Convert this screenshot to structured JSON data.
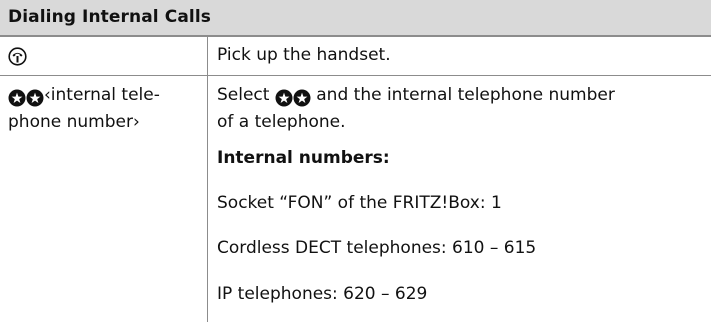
{
  "header": {
    "title": "Dialing Internal Calls"
  },
  "rows": [
    {
      "action_icon": "handset-icon",
      "instruction": "Pick up the handset."
    },
    {
      "action_icons": [
        "star-key-icon",
        "star-key-icon"
      ],
      "action_text_line1": "‹internal tele-",
      "action_text_line2": "phone number›",
      "instruction_prefix": "Select",
      "instruction_suffix": "and the internal telephone number",
      "instruction_line2": "of a telephone.",
      "subheading": "Internal numbers:",
      "numbers": [
        "Socket “FON” of the FRITZ!Box: 1",
        "Cordless DECT telephones: 610 – 615",
        "IP telephones: 620 – 629"
      ]
    }
  ],
  "colors": {
    "header_background": "#d9d9d9",
    "rule": "#8c8c8c",
    "text": "#111111"
  }
}
